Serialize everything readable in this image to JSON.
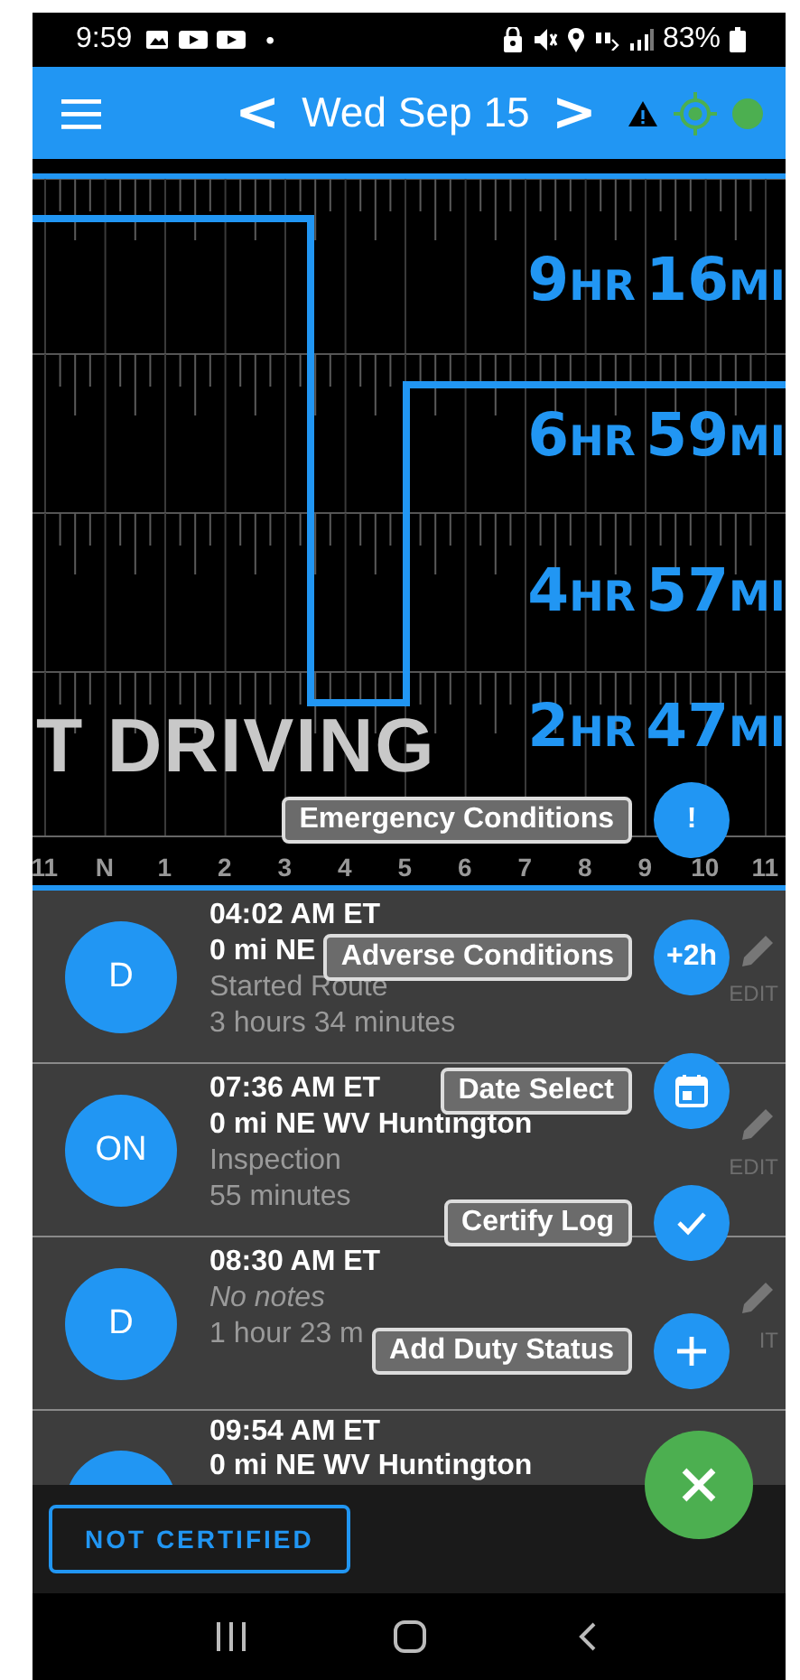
{
  "status_bar": {
    "time": "9:59",
    "dot": "•",
    "battery": "83%"
  },
  "app_bar": {
    "prev": "<",
    "date": "Wed Sep 15",
    "next": ">"
  },
  "log_graph": {
    "clocks": [
      {
        "hours": "9",
        "hr_unit": "HR",
        "minutes": "16",
        "min_unit": "MI"
      },
      {
        "hours": "6",
        "hr_unit": "HR",
        "minutes": "59",
        "min_unit": "MI"
      },
      {
        "hours": "4",
        "hr_unit": "HR",
        "minutes": "57",
        "min_unit": "MI"
      },
      {
        "hours": "2",
        "hr_unit": "HR",
        "minutes": "47",
        "min_unit": "MI"
      }
    ],
    "status_text": "T DRIVING",
    "hours": [
      "11",
      "N",
      "1",
      "2",
      "3",
      "4",
      "5",
      "6",
      "7",
      "8",
      "9",
      "10",
      "11"
    ]
  },
  "events": [
    {
      "status": "D",
      "time": "04:02 AM ET",
      "location": "0 mi NE",
      "note": "Started Route",
      "note_italic": false,
      "duration": "3 hours 34 minutes",
      "edit_label": "EDIT"
    },
    {
      "status": "ON",
      "time": "07:36 AM ET",
      "location": "0 mi NE WV Huntington",
      "note": "Inspection",
      "note_italic": false,
      "duration": "55 minutes",
      "edit_label": "EDIT"
    },
    {
      "status": "D",
      "time": "08:30 AM ET",
      "note": "No notes",
      "note_italic": true,
      "duration": "1 hour 23 m",
      "edit_label": "IT"
    },
    {
      "time": "09:54 AM ET",
      "location": "0 mi NE WV Huntington"
    }
  ],
  "footer": {
    "certify_button": "NOT CERTIFIED"
  },
  "speed_dial": [
    {
      "label": "Emergency Conditions",
      "kind": "text",
      "text": "!"
    },
    {
      "label": "Adverse Conditions",
      "kind": "text",
      "text": "+2h"
    },
    {
      "label": "Date Select",
      "kind": "calendar"
    },
    {
      "label": "Certify Log",
      "kind": "check"
    },
    {
      "label": "Add Duty Status",
      "kind": "plus"
    }
  ]
}
